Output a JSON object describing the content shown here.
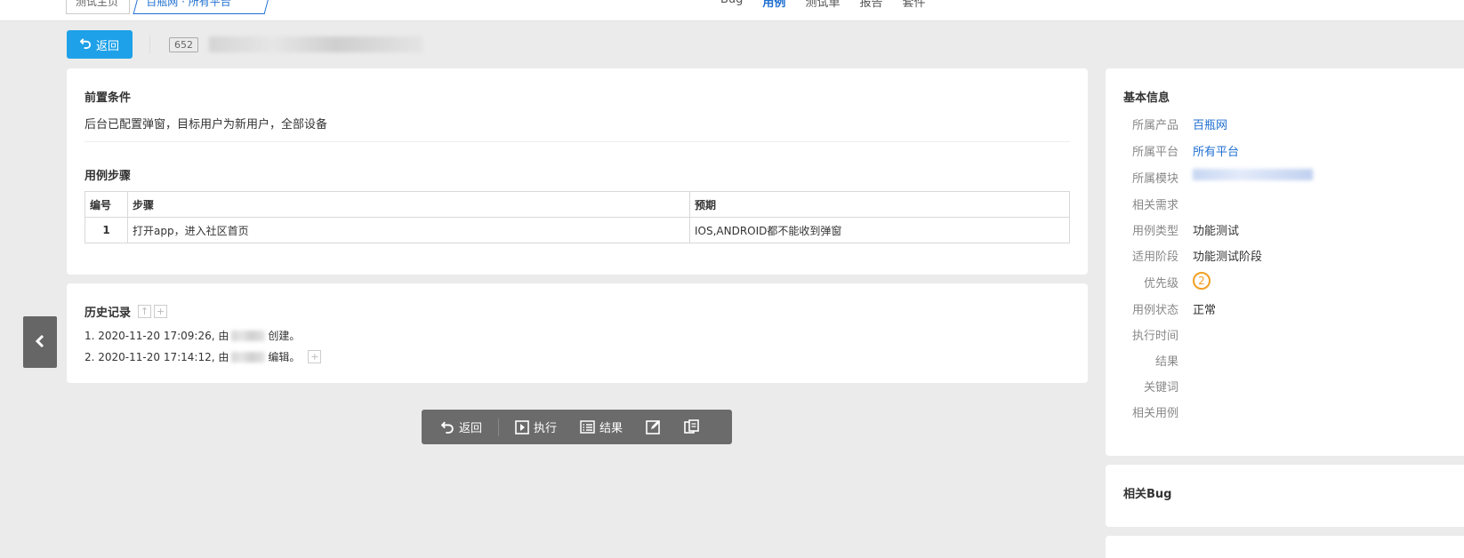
{
  "topbar": {
    "crumbs": [
      "测试主页",
      "百瓶网 · 所有平台"
    ],
    "nav": [
      "Bug",
      "用例",
      "测试单",
      "报告",
      "套件"
    ],
    "active_nav": "用例"
  },
  "header": {
    "back_label": "返回",
    "case_id": "652"
  },
  "main": {
    "precondition_title": "前置条件",
    "precondition_text": "后台已配置弹窗，目标用户为新用户，全部设备",
    "steps_title": "用例步骤",
    "columns": [
      "编号",
      "步骤",
      "预期"
    ],
    "rows": [
      {
        "num": "1",
        "step": "打开app，进入社区首页",
        "expect": "IOS,ANDROID都不能收到弹窗"
      }
    ]
  },
  "history": {
    "title": "历史记录",
    "entries": [
      {
        "prefix": "1. 2020-11-20 17:09:26, 由",
        "action": "创建。"
      },
      {
        "prefix": "2. 2020-11-20 17:14:12, 由",
        "action": "编辑。"
      }
    ]
  },
  "toolbar": {
    "back_label": "返回",
    "run_label": "执行",
    "result_label": "结果"
  },
  "info": {
    "title": "基本信息",
    "fields": [
      {
        "k": "所属产品",
        "v": "百瓶网",
        "link": true
      },
      {
        "k": "所属平台",
        "v": "所有平台",
        "link": true
      },
      {
        "k": "所属模块",
        "v": "",
        "link": true
      },
      {
        "k": "相关需求",
        "v": ""
      },
      {
        "k": "用例类型",
        "v": "功能测试"
      },
      {
        "k": "适用阶段",
        "v": "功能测试阶段"
      },
      {
        "k": "优先级",
        "v": "2"
      },
      {
        "k": "用例状态",
        "v": "正常"
      },
      {
        "k": "执行时间",
        "v": ""
      },
      {
        "k": "结果",
        "v": ""
      },
      {
        "k": "关键词",
        "v": ""
      },
      {
        "k": "相关用例",
        "v": ""
      }
    ]
  },
  "bug_panel": {
    "title": "相关Bug"
  },
  "colors": {
    "accent": "#1ea1e8",
    "link": "#1f6fd1",
    "priority": "#f0a024",
    "toolbar": "#6b6b6b"
  },
  "icons": [
    "undo-icon",
    "play-icon",
    "list-icon",
    "edit-icon",
    "copy-icon",
    "chevron-left-icon"
  ]
}
